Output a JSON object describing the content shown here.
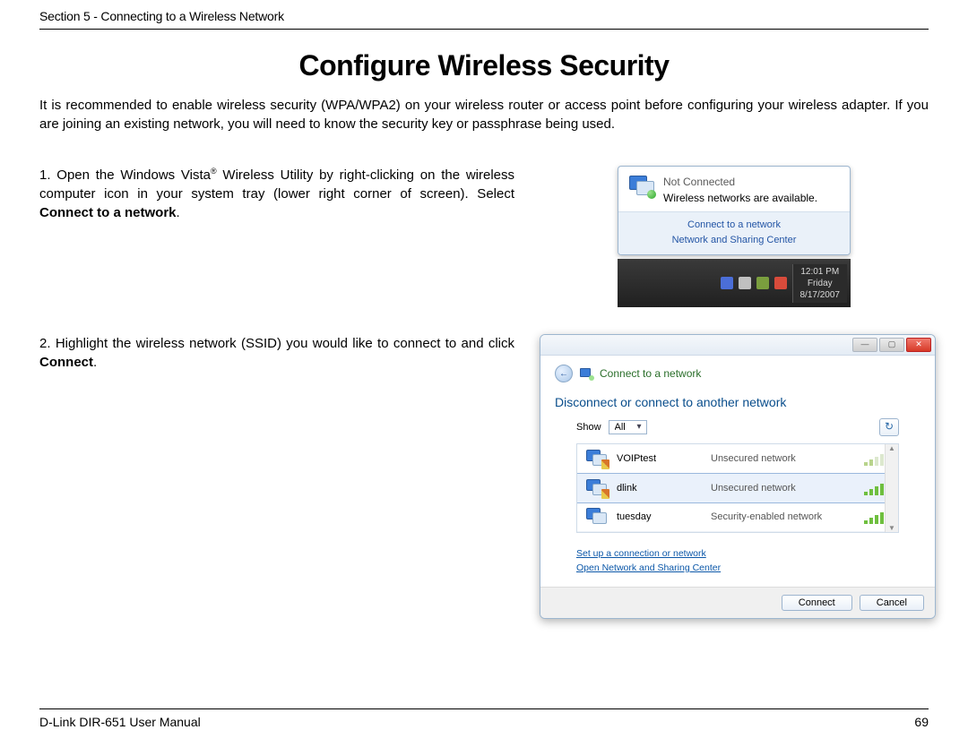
{
  "header": {
    "section": "Section 5 - Connecting to a Wireless Network"
  },
  "title": "Configure Wireless Security",
  "intro": "It is recommended to enable wireless security (WPA/WPA2) on your wireless router or access point before configuring your wireless adapter. If you are joining an existing network, you will need to know the security key or passphrase being used.",
  "steps": {
    "s1": {
      "num": "1.",
      "text_a": "Open the Windows Vista",
      "text_b": " Wireless Utility by right-clicking on the wireless computer icon in your system tray (lower right corner of screen). Select ",
      "bold": "Connect to a network",
      "text_c": "."
    },
    "s2": {
      "num": "2.",
      "text_a": "Highlight the wireless network (SSID) you would like to connect to and click ",
      "bold": "Connect",
      "text_b": "."
    }
  },
  "fig1": {
    "not_connected": "Not Connected",
    "available": "Wireless networks are available.",
    "link1": "Connect to a network",
    "link2": "Network and Sharing Center",
    "clock": {
      "time": "12:01 PM",
      "day": "Friday",
      "date": "8/17/2007"
    }
  },
  "fig2": {
    "title": "Connect to a network",
    "heading": "Disconnect or connect to another network",
    "show_label": "Show",
    "show_value": "All",
    "networks": [
      {
        "name": "VOIPtest",
        "type": "Unsecured network",
        "shield": true,
        "signal": "weak"
      },
      {
        "name": "dlink",
        "type": "Unsecured network",
        "shield": true,
        "signal": "strong",
        "selected": true
      },
      {
        "name": "tuesday",
        "type": "Security-enabled network",
        "shield": false,
        "signal": "strong"
      }
    ],
    "link_setup": "Set up a connection or network",
    "link_center": "Open Network and Sharing Center",
    "btn_connect": "Connect",
    "btn_cancel": "Cancel"
  },
  "footer": {
    "manual": "D-Link DIR-651 User Manual",
    "page": "69"
  }
}
